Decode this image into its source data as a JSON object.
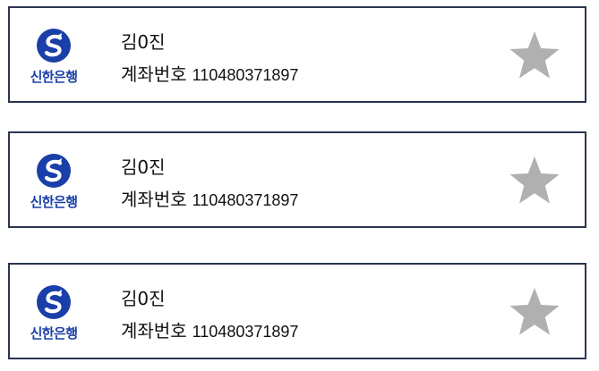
{
  "colors": {
    "card_border": "#2b3550",
    "bank_blue": "#1a3fa8",
    "star_gray": "#b0b0b0"
  },
  "cards": [
    {
      "bank_logo_icon": "shinhan-bank-logo",
      "bank_name": "신한은행",
      "holder_name": "김0진",
      "account_label": "계좌번호",
      "account_number": "110480371897",
      "favorite_icon": "star-icon"
    },
    {
      "bank_logo_icon": "shinhan-bank-logo",
      "bank_name": "신한은행",
      "holder_name": "김0진",
      "account_label": "계좌번호",
      "account_number": "110480371897",
      "favorite_icon": "star-icon"
    },
    {
      "bank_logo_icon": "shinhan-bank-logo",
      "bank_name": "신한은행",
      "holder_name": "김0진",
      "account_label": "계좌번호",
      "account_number": "110480371897",
      "favorite_icon": "star-icon"
    }
  ]
}
